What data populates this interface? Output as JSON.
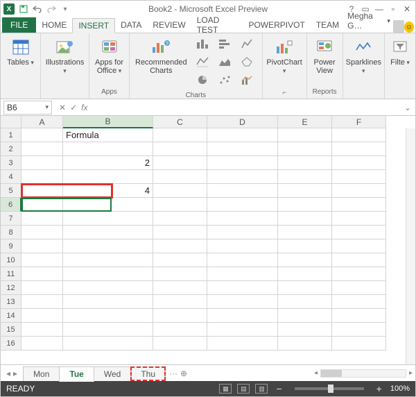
{
  "window": {
    "title": "Book2 - Microsoft Excel Preview",
    "user": "Megha G…"
  },
  "ribbon": {
    "file": "FILE",
    "tabs": [
      "HOME",
      "INSERT",
      "DATA",
      "REVIEW",
      "LOAD TEST",
      "POWERPIVOT",
      "TEAM"
    ],
    "active": "INSERT",
    "groups": {
      "tables": {
        "btn": "Tables",
        "label": ""
      },
      "illustrations": {
        "btn": "Illustrations",
        "label": ""
      },
      "apps": {
        "btn": "Apps for\nOffice",
        "label": "Apps"
      },
      "recommended": {
        "btn": "Recommended\nCharts",
        "label": "Charts"
      },
      "pivotchart": {
        "btn": "PivotChart",
        "label": ""
      },
      "powerview": {
        "btn": "Power\nView",
        "label": "Reports"
      },
      "sparklines": {
        "btn": "Sparklines",
        "label": ""
      },
      "filter": {
        "btn": "Filte",
        "label": ""
      }
    }
  },
  "formula_bar": {
    "name_box": "B6",
    "fx_label": "fx",
    "value": ""
  },
  "grid": {
    "columns": [
      "A",
      "B",
      "C",
      "D",
      "E",
      "F"
    ],
    "rows": 16,
    "active_row": 6,
    "active_col": "B",
    "cells": {
      "B1": "Formula",
      "B3": "2",
      "B5": "4"
    }
  },
  "sheets": {
    "tabs": [
      "Mon",
      "Tue",
      "Wed",
      "Thu"
    ],
    "active": "Tue",
    "highlighted": "Thu",
    "more": "···"
  },
  "status": {
    "ready": "READY",
    "zoom": "100%"
  }
}
